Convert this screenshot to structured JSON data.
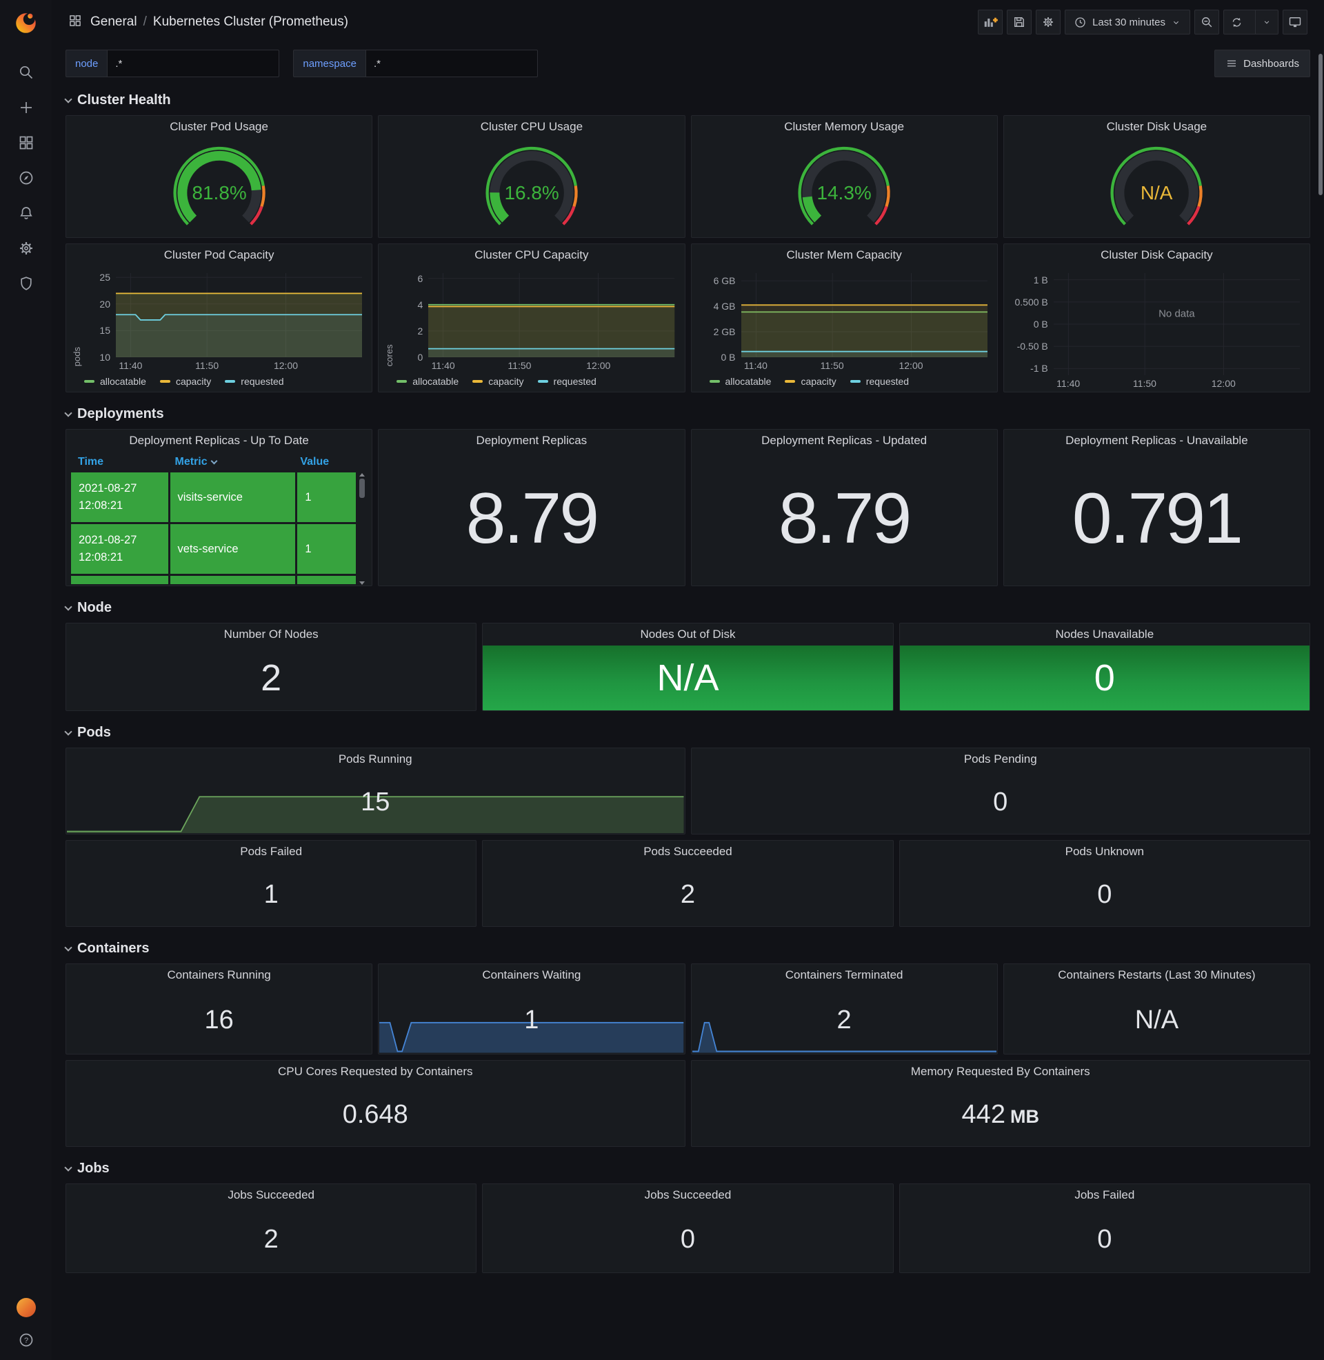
{
  "nav": {
    "breadcrumb": {
      "section": "General",
      "separator": "/",
      "title": "Kubernetes Cluster (Prometheus)"
    },
    "time_range": "Last 30 minutes",
    "dashboards_button": "Dashboards"
  },
  "variables": [
    {
      "label": "node",
      "value": ".*"
    },
    {
      "label": "namespace",
      "value": ".*"
    }
  ],
  "sections": {
    "cluster_health": "Cluster Health",
    "deployments": "Deployments",
    "node": "Node",
    "pods": "Pods",
    "containers": "Containers",
    "jobs": "Jobs"
  },
  "sidebar": {
    "help_label": "?"
  },
  "gauge_ring": [
    {
      "from": 0,
      "to": 0.8,
      "color": "#3CB43C"
    },
    {
      "from": 0.8,
      "to": 0.9,
      "color": "#ED8128"
    },
    {
      "from": 0.9,
      "to": 1,
      "color": "#E02F44"
    }
  ],
  "gauges": [
    {
      "title": "Cluster Pod Usage",
      "value": "81.8%",
      "percent": 81.8,
      "color": "#3CB43C"
    },
    {
      "title": "Cluster CPU Usage",
      "value": "16.8%",
      "percent": 16.8,
      "color": "#3CB43C"
    },
    {
      "title": "Cluster Memory Usage",
      "value": "14.3%",
      "percent": 14.3,
      "color": "#3CB43C"
    },
    {
      "title": "Cluster Disk Usage",
      "value": "N/A",
      "percent": null,
      "color": "#EAB839"
    }
  ],
  "capacity_charts": [
    {
      "title": "Cluster Pod Capacity",
      "type": "line",
      "ylabel": "pods",
      "ymin": 10,
      "ymax": 25.8,
      "yticks": [
        {
          "v": 10,
          "label": "10"
        },
        {
          "v": 15,
          "label": "15"
        },
        {
          "v": 20,
          "label": "20"
        },
        {
          "v": 25,
          "label": "25"
        }
      ],
      "xticks": [
        {
          "f": 0.06,
          "label": "11:40"
        },
        {
          "f": 0.37,
          "label": "11:50"
        },
        {
          "f": 0.69,
          "label": "12:00"
        }
      ],
      "series": [
        {
          "name": "allocatable",
          "color": "#73BF69",
          "fillOpacity": 0.1,
          "points": [
            [
              0,
              22
            ],
            [
              1,
              22
            ]
          ]
        },
        {
          "name": "capacity",
          "color": "#EAB839",
          "fillOpacity": 0.13,
          "points": [
            [
              0,
              22
            ],
            [
              1,
              22
            ]
          ]
        },
        {
          "name": "requested",
          "color": "#6ED0E0",
          "fillOpacity": 0.1,
          "points": [
            [
              0,
              18
            ],
            [
              0.08,
              18
            ],
            [
              0.1,
              17
            ],
            [
              0.18,
              17
            ],
            [
              0.2,
              18
            ],
            [
              1,
              18
            ]
          ]
        }
      ],
      "legend": [
        {
          "label": "allocatable",
          "color": "#73BF69"
        },
        {
          "label": "capacity",
          "color": "#EAB839"
        },
        {
          "label": "requested",
          "color": "#6ED0E0"
        }
      ]
    },
    {
      "title": "Cluster CPU Capacity",
      "type": "line",
      "ylabel": "cores",
      "ymin": 0,
      "ymax": 6.4,
      "yticks": [
        {
          "v": 0,
          "label": "0"
        },
        {
          "v": 2,
          "label": "2"
        },
        {
          "v": 4,
          "label": "4"
        },
        {
          "v": 6,
          "label": "6"
        }
      ],
      "xticks": [
        {
          "f": 0.06,
          "label": "11:40"
        },
        {
          "f": 0.37,
          "label": "11:50"
        },
        {
          "f": 0.69,
          "label": "12:00"
        }
      ],
      "series": [
        {
          "name": "allocatable",
          "color": "#73BF69",
          "fillOpacity": 0.1,
          "points": [
            [
              0,
              4
            ],
            [
              1,
              4
            ]
          ]
        },
        {
          "name": "capacity",
          "color": "#EAB839",
          "fillOpacity": 0.13,
          "points": [
            [
              0,
              3.86
            ],
            [
              1,
              3.86
            ]
          ]
        },
        {
          "name": "requested",
          "color": "#6ED0E0",
          "fillOpacity": 0.1,
          "points": [
            [
              0,
              0.65
            ],
            [
              1,
              0.65
            ]
          ]
        }
      ],
      "legend": [
        {
          "label": "allocatable",
          "color": "#73BF69"
        },
        {
          "label": "capacity",
          "color": "#EAB839"
        },
        {
          "label": "requested",
          "color": "#6ED0E0"
        }
      ]
    },
    {
      "title": "Cluster Mem Capacity",
      "type": "line",
      "ylabel": "",
      "ymin": 0,
      "ymax": 6.6,
      "yticks": [
        {
          "v": 0,
          "label": "0 B"
        },
        {
          "v": 2,
          "label": "2 GB"
        },
        {
          "v": 4,
          "label": "4 GB"
        },
        {
          "v": 6,
          "label": "6 GB"
        }
      ],
      "xticks": [
        {
          "f": 0.06,
          "label": "11:40"
        },
        {
          "f": 0.37,
          "label": "11:50"
        },
        {
          "f": 0.69,
          "label": "12:00"
        }
      ],
      "series": [
        {
          "name": "allocatable",
          "color": "#73BF69",
          "fillOpacity": 0.1,
          "points": [
            [
              0,
              3.55
            ],
            [
              1,
              3.55
            ]
          ]
        },
        {
          "name": "capacity",
          "color": "#EAB839",
          "fillOpacity": 0.13,
          "points": [
            [
              0,
              4.1
            ],
            [
              1,
              4.1
            ]
          ]
        },
        {
          "name": "requested",
          "color": "#6ED0E0",
          "fillOpacity": 0.1,
          "points": [
            [
              0,
              0.45
            ],
            [
              1,
              0.45
            ]
          ]
        }
      ],
      "legend": [
        {
          "label": "allocatable",
          "color": "#73BF69"
        },
        {
          "label": "capacity",
          "color": "#EAB839"
        },
        {
          "label": "requested",
          "color": "#6ED0E0"
        }
      ]
    },
    {
      "title": "Cluster Disk Capacity",
      "type": "line",
      "ylabel": "",
      "ymin": -1.15,
      "ymax": 1.15,
      "no_data": "No data",
      "yticks": [
        {
          "v": -1,
          "label": "-1 B"
        },
        {
          "v": -0.5,
          "label": "-0.50 B"
        },
        {
          "v": 0,
          "label": "0 B"
        },
        {
          "v": 0.5,
          "label": "0.500 B"
        },
        {
          "v": 1,
          "label": "1 B"
        }
      ],
      "xticks": [
        {
          "f": 0.06,
          "label": "11:40"
        },
        {
          "f": 0.37,
          "label": "11:50"
        },
        {
          "f": 0.69,
          "label": "12:00"
        }
      ]
    }
  ],
  "deployments": {
    "table": {
      "title": "Deployment Replicas - Up To Date",
      "columns": [
        "Time",
        "Metric",
        "Value"
      ],
      "rows": [
        {
          "time": "2021-08-27 12:08:21",
          "metric": "visits-service",
          "value": "1"
        },
        {
          "time": "2021-08-27 12:08:21",
          "metric": "vets-service",
          "value": "1"
        }
      ]
    },
    "stats": [
      {
        "title": "Deployment Replicas",
        "value": "8.79"
      },
      {
        "title": "Deployment Replicas - Updated",
        "value": "8.79"
      },
      {
        "title": "Deployment Replicas - Unavailable",
        "value": "0.791"
      }
    ]
  },
  "node_panels": [
    {
      "title": "Number Of Nodes",
      "value": "2"
    },
    {
      "title": "Nodes Out of Disk",
      "value": "N/A"
    },
    {
      "title": "Nodes Unavailable",
      "value": "0"
    }
  ],
  "pods_panels": {
    "running": {
      "title": "Pods Running",
      "value": "15",
      "spark": {
        "color": "#6ca65c",
        "fillOpacity": 0.28,
        "height": 72,
        "points": [
          [
            0,
            0.04
          ],
          [
            0.185,
            0.04
          ],
          [
            0.215,
            0.8
          ],
          [
            1,
            0.8
          ]
        ]
      }
    },
    "pending": {
      "title": "Pods Pending",
      "value": "0"
    },
    "failed": {
      "title": "Pods Failed",
      "value": "1"
    },
    "succeeded": {
      "title": "Pods Succeeded",
      "value": "2"
    },
    "unknown": {
      "title": "Pods Unknown",
      "value": "0"
    }
  },
  "containers_panels": {
    "running": {
      "title": "Containers Running",
      "value": "16"
    },
    "waiting": {
      "title": "Containers Waiting",
      "value": "1",
      "spark": {
        "color": "#4585d6",
        "fillOpacity": 0.32,
        "height": 72,
        "points": [
          [
            0,
            0.62
          ],
          [
            0.035,
            0.62
          ],
          [
            0.06,
            0.03
          ],
          [
            0.075,
            0.03
          ],
          [
            0.105,
            0.62
          ],
          [
            1,
            0.62
          ]
        ]
      }
    },
    "terminated": {
      "title": "Containers Terminated",
      "value": "2",
      "spark": {
        "color": "#4585d6",
        "fillOpacity": 0.32,
        "height": 72,
        "points": [
          [
            0,
            0.03
          ],
          [
            0.02,
            0.03
          ],
          [
            0.04,
            0.62
          ],
          [
            0.055,
            0.62
          ],
          [
            0.08,
            0.03
          ],
          [
            1,
            0.03
          ]
        ]
      }
    },
    "restarts": {
      "title": "Containers Restarts (Last 30 Minutes)",
      "value": "N/A"
    },
    "cpu_req": {
      "title": "CPU Cores Requested by Containers",
      "value": "0.648"
    },
    "mem_req": {
      "title": "Memory Requested By Containers",
      "value": "442",
      "unit": "MB"
    }
  },
  "jobs_panels": [
    {
      "title": "Jobs Succeeded",
      "value": "2"
    },
    {
      "title": "Jobs Succeeded",
      "value": "0"
    },
    {
      "title": "Jobs Failed",
      "value": "0"
    }
  ]
}
